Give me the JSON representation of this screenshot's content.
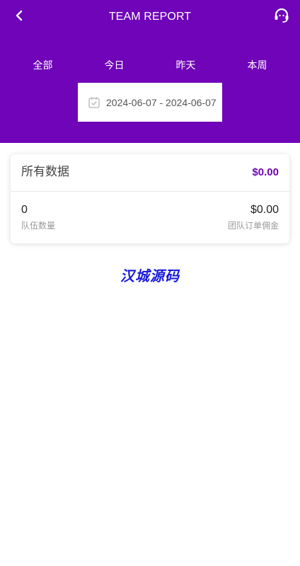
{
  "header": {
    "title": "TEAM REPORT",
    "back_icon": "chevron-left-icon",
    "support_icon": "headset-icon",
    "background_color": "#6f04b8"
  },
  "tabs": [
    {
      "label": "全部"
    },
    {
      "label": "今日"
    },
    {
      "label": "昨天"
    },
    {
      "label": "本周"
    }
  ],
  "date_range": {
    "icon": "calendar-check-icon",
    "text": "2024-06-07 -  2024-06-07"
  },
  "summary": {
    "title": "所有数据",
    "total": "$0.00",
    "team_count": {
      "value": "0",
      "label": "队伍数量"
    },
    "commission": {
      "value": "$0.00",
      "label": "团队订单佣金"
    }
  },
  "watermark": {
    "text": "汉城源码",
    "color": "#1a1adb"
  }
}
